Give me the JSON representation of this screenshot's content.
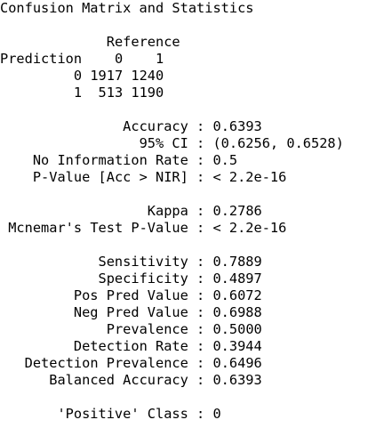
{
  "title": "Confusion Matrix and Statistics",
  "matrix": {
    "reference_label": "Reference",
    "prediction_label": "Prediction",
    "col0": "0",
    "col1": "1",
    "rows": [
      {
        "label": "0",
        "c0": "1917",
        "c1": "1240"
      },
      {
        "label": "1",
        "c0": "513",
        "c1": "1190"
      }
    ]
  },
  "stats": {
    "accuracy": {
      "label": "Accuracy",
      "value": "0.6393"
    },
    "ci": {
      "label": "95% CI",
      "value": "(0.6256, 0.6528)"
    },
    "nir": {
      "label": "No Information Rate",
      "value": "0.5"
    },
    "pvalue": {
      "label": "P-Value [Acc > NIR]",
      "value": "< 2.2e-16"
    },
    "kappa": {
      "label": "Kappa",
      "value": "0.2786"
    },
    "mcnemar": {
      "label": "Mcnemar's Test P-Value",
      "value": "< 2.2e-16"
    },
    "sensitivity": {
      "label": "Sensitivity",
      "value": "0.7889"
    },
    "specificity": {
      "label": "Specificity",
      "value": "0.4897"
    },
    "ppv": {
      "label": "Pos Pred Value",
      "value": "0.6072"
    },
    "npv": {
      "label": "Neg Pred Value",
      "value": "0.6988"
    },
    "prevalence": {
      "label": "Prevalence",
      "value": "0.5000"
    },
    "detection_rate": {
      "label": "Detection Rate",
      "value": "0.3944"
    },
    "detection_prevalence": {
      "label": "Detection Prevalence",
      "value": "0.6496"
    },
    "balanced_accuracy": {
      "label": "Balanced Accuracy",
      "value": "0.6393"
    }
  },
  "positive_class": {
    "label": "'Positive' Class",
    "value": "0"
  },
  "separator": " : "
}
